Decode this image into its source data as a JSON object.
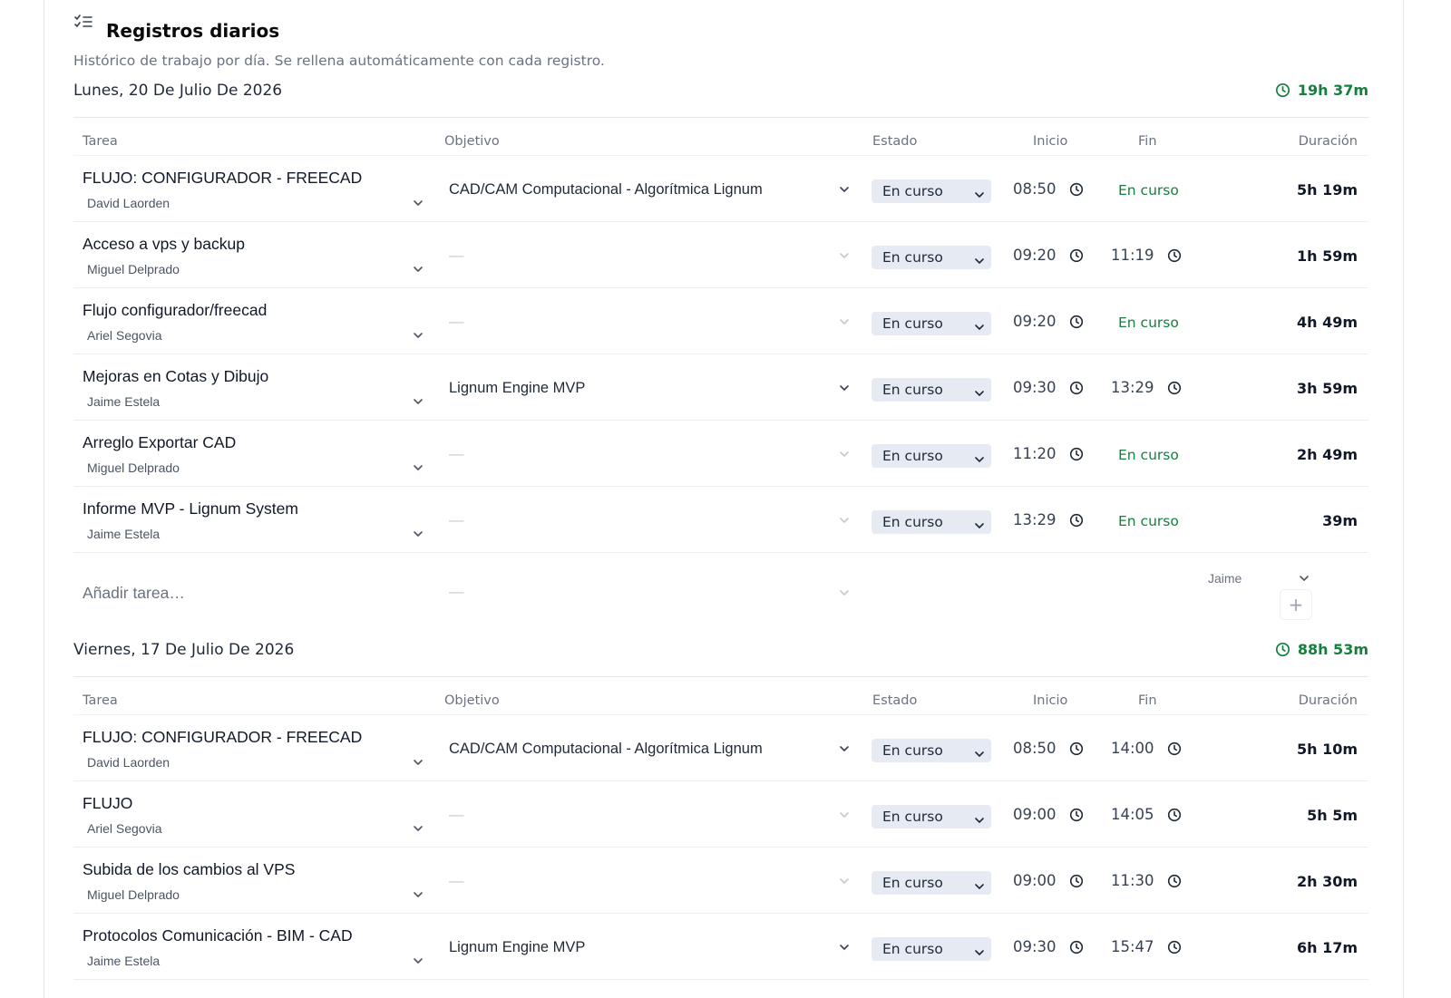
{
  "header": {
    "title": "Registros diarios",
    "subtitle": "Histórico de trabajo por día. Se rellena automáticamente con cada registro.",
    "icon": "checklist-icon"
  },
  "columns": {
    "task": "Tarea",
    "objective": "Objetivo",
    "status": "Estado",
    "start": "Inicio",
    "end": "Fin",
    "duration": "Duración"
  },
  "empty_placeholder": "—",
  "colors": {
    "accent_green": "#15803d",
    "status_bg": "#e6ebf3"
  },
  "days": [
    {
      "date": "Lunes, 20 De Julio De 2026",
      "total": "19h 37m",
      "rows": [
        {
          "task": "FLUJO: CONFIGURADOR - FREECAD",
          "person": "David Laorden",
          "objective": "CAD/CAM Computacional - Algorítmica Lignum",
          "status": "En curso",
          "start": "08:50",
          "end": "En curso",
          "duration": "5h 19m"
        },
        {
          "task": "Acceso a vps y backup",
          "person": "Miguel Delprado",
          "objective": "—",
          "status": "En curso",
          "start": "09:20",
          "end": "11:19",
          "duration": "1h 59m"
        },
        {
          "task": "Flujo configurador/freecad",
          "person": "Ariel Segovia",
          "objective": "—",
          "status": "En curso",
          "start": "09:20",
          "end": "En curso",
          "duration": "4h 49m"
        },
        {
          "task": "Mejoras en Cotas y Dibujo",
          "person": "Jaime Estela",
          "objective": "Lignum Engine MVP",
          "status": "En curso",
          "start": "09:30",
          "end": "13:29",
          "duration": "3h 59m"
        },
        {
          "task": "Arreglo Exportar CAD",
          "person": "Miguel Delprado",
          "objective": "—",
          "status": "En curso",
          "start": "11:20",
          "end": "En curso",
          "duration": "2h 49m"
        },
        {
          "task": "Informe MVP - Lignum System",
          "person": "Jaime Estela",
          "objective": "—",
          "status": "En curso",
          "start": "13:29",
          "end": "En curso",
          "duration": "39m"
        }
      ],
      "add_row": {
        "placeholder": "Añadir tarea…",
        "objective": "—",
        "assignee": "Jaime",
        "add_symbol": "+"
      }
    },
    {
      "date": "Viernes, 17 De Julio De 2026",
      "total": "88h 53m",
      "rows": [
        {
          "task": "FLUJO: CONFIGURADOR - FREECAD",
          "person": "David Laorden",
          "objective": "CAD/CAM Computacional - Algorítmica Lignum",
          "status": "En curso",
          "start": "08:50",
          "end": "14:00",
          "duration": "5h 10m"
        },
        {
          "task": "FLUJO",
          "person": "Ariel Segovia",
          "objective": "—",
          "status": "En curso",
          "start": "09:00",
          "end": "14:05",
          "duration": "5h 5m"
        },
        {
          "task": "Subida de los cambios al VPS",
          "person": "Miguel Delprado",
          "objective": "—",
          "status": "En curso",
          "start": "09:00",
          "end": "11:30",
          "duration": "2h 30m"
        },
        {
          "task": "Protocolos Comunicación - BIM - CAD",
          "person": "Jaime Estela",
          "objective": "Lignum Engine MVP",
          "status": "En curso",
          "start": "09:30",
          "end": "15:47",
          "duration": "6h 17m"
        }
      ]
    }
  ]
}
